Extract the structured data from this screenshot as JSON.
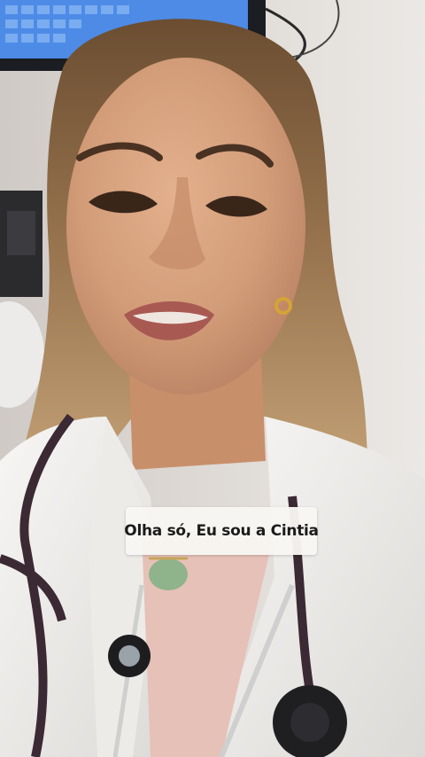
{
  "video": {
    "caption": "Olha só, Eu sou a Cintia"
  },
  "colors": {
    "wall": "#e3dfdb",
    "coat": "#f4f3f1",
    "hair": "#8a6a44",
    "skin": "#d6a07e",
    "stethoscope": "#3b2a33",
    "monitor": "#4d8be6"
  }
}
